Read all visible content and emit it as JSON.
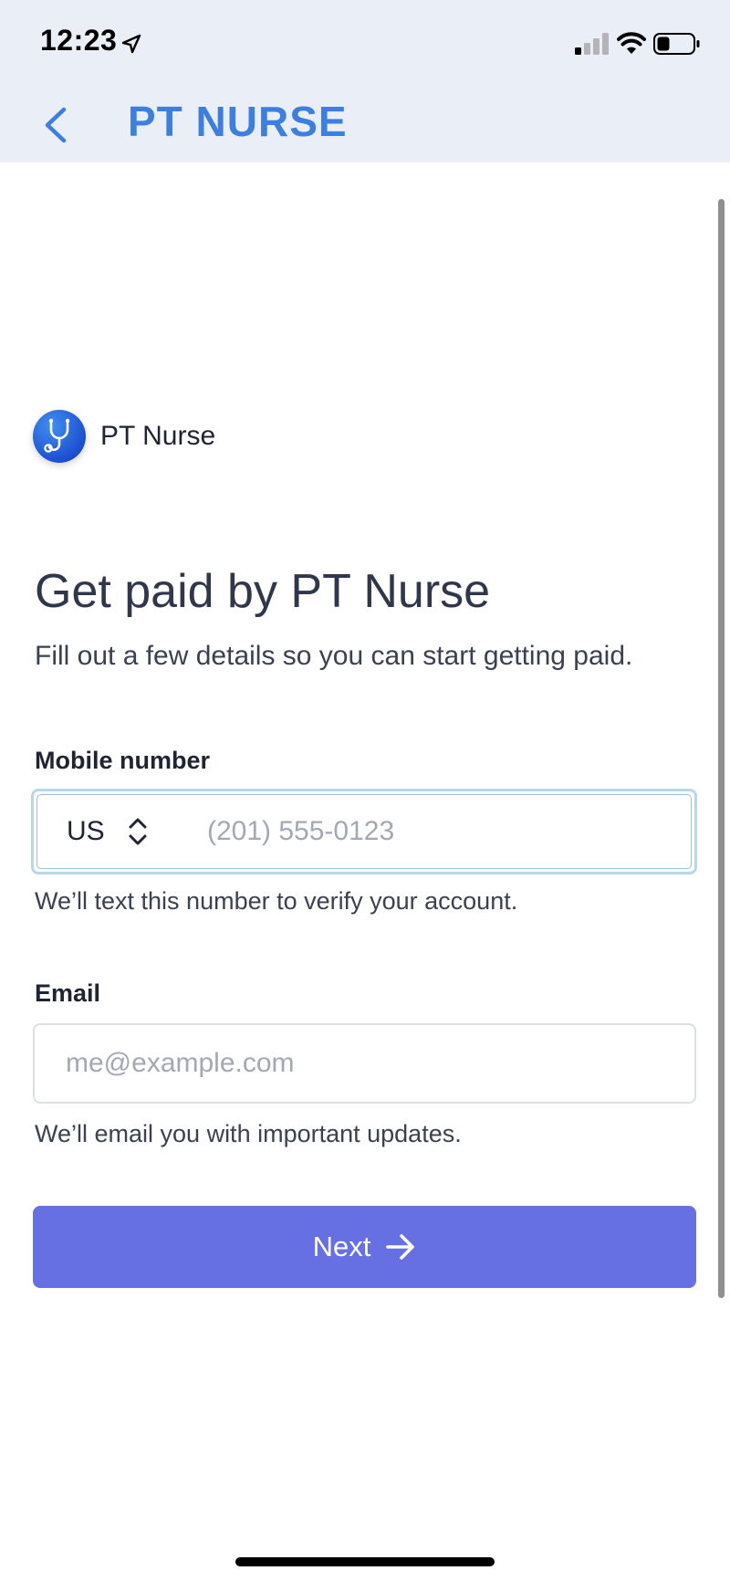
{
  "status_bar": {
    "time": "12:23",
    "icons": [
      "location-arrow-icon",
      "cellular-signal-icon",
      "wifi-icon",
      "battery-icon"
    ]
  },
  "nav": {
    "back_icon": "chevron-left-icon",
    "title": "PT NURSE",
    "title_color": "#3d7fe0",
    "background": "#e9eef7"
  },
  "brand": {
    "logo_icon": "stethoscope-icon",
    "name": "PT Nurse"
  },
  "form": {
    "heading": "Get paid by PT Nurse",
    "subheading": "Fill out a few details so you can start getting paid.",
    "phone": {
      "label": "Mobile number",
      "country_code": "US",
      "placeholder": "(201) 555-0123",
      "value": "",
      "help": "We’ll text this number to verify your account."
    },
    "email": {
      "label": "Email",
      "placeholder": "me@example.com",
      "value": "",
      "help": "We’ll email you with important updates."
    },
    "next_button": {
      "label": "Next",
      "icon": "arrow-right-icon",
      "color": "#6770e3"
    }
  }
}
